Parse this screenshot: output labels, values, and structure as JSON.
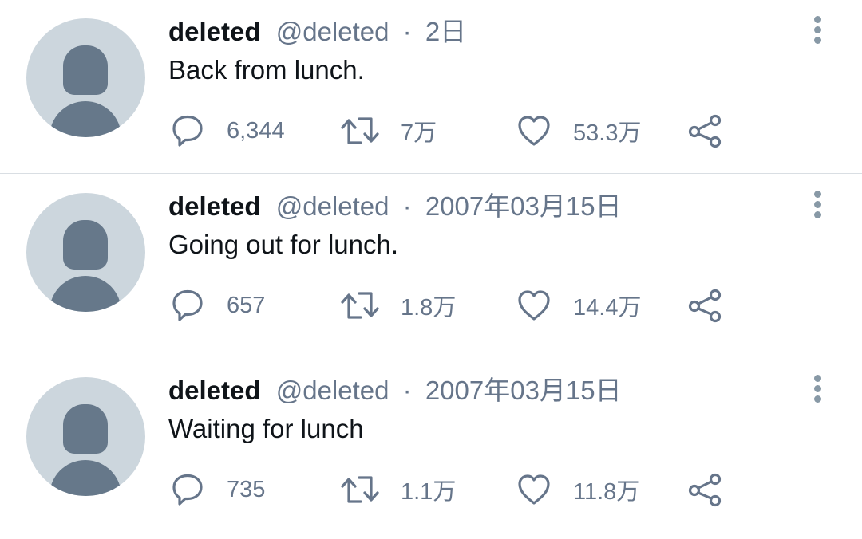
{
  "tweets": [
    {
      "name": "deleted",
      "handle": "@deleted",
      "separator": "·",
      "time": "2日",
      "text": "Back from lunch.",
      "replies": "6,344",
      "retweets": "7万",
      "likes": "53.3万"
    },
    {
      "name": "deleted",
      "handle": "@deleted",
      "separator": "·",
      "time": "2007年03月15日",
      "text": "Going out for lunch.",
      "replies": "657",
      "retweets": "1.8万",
      "likes": "14.4万"
    },
    {
      "name": "deleted",
      "handle": "@deleted",
      "separator": "·",
      "time": "2007年03月15日",
      "text": "Waiting for lunch",
      "replies": "735",
      "retweets": "1.1万",
      "likes": "11.8万"
    }
  ],
  "icons": {
    "reply": "reply-icon",
    "retweet": "retweet-icon",
    "like": "heart-icon",
    "share": "share-icon",
    "more": "more-vertical-icon",
    "avatar": "default-avatar"
  },
  "colors": {
    "icon": "#66758a",
    "avatar_bg": "#ccd6dd",
    "avatar_fg": "#66788a",
    "divider": "#d9dee3"
  }
}
